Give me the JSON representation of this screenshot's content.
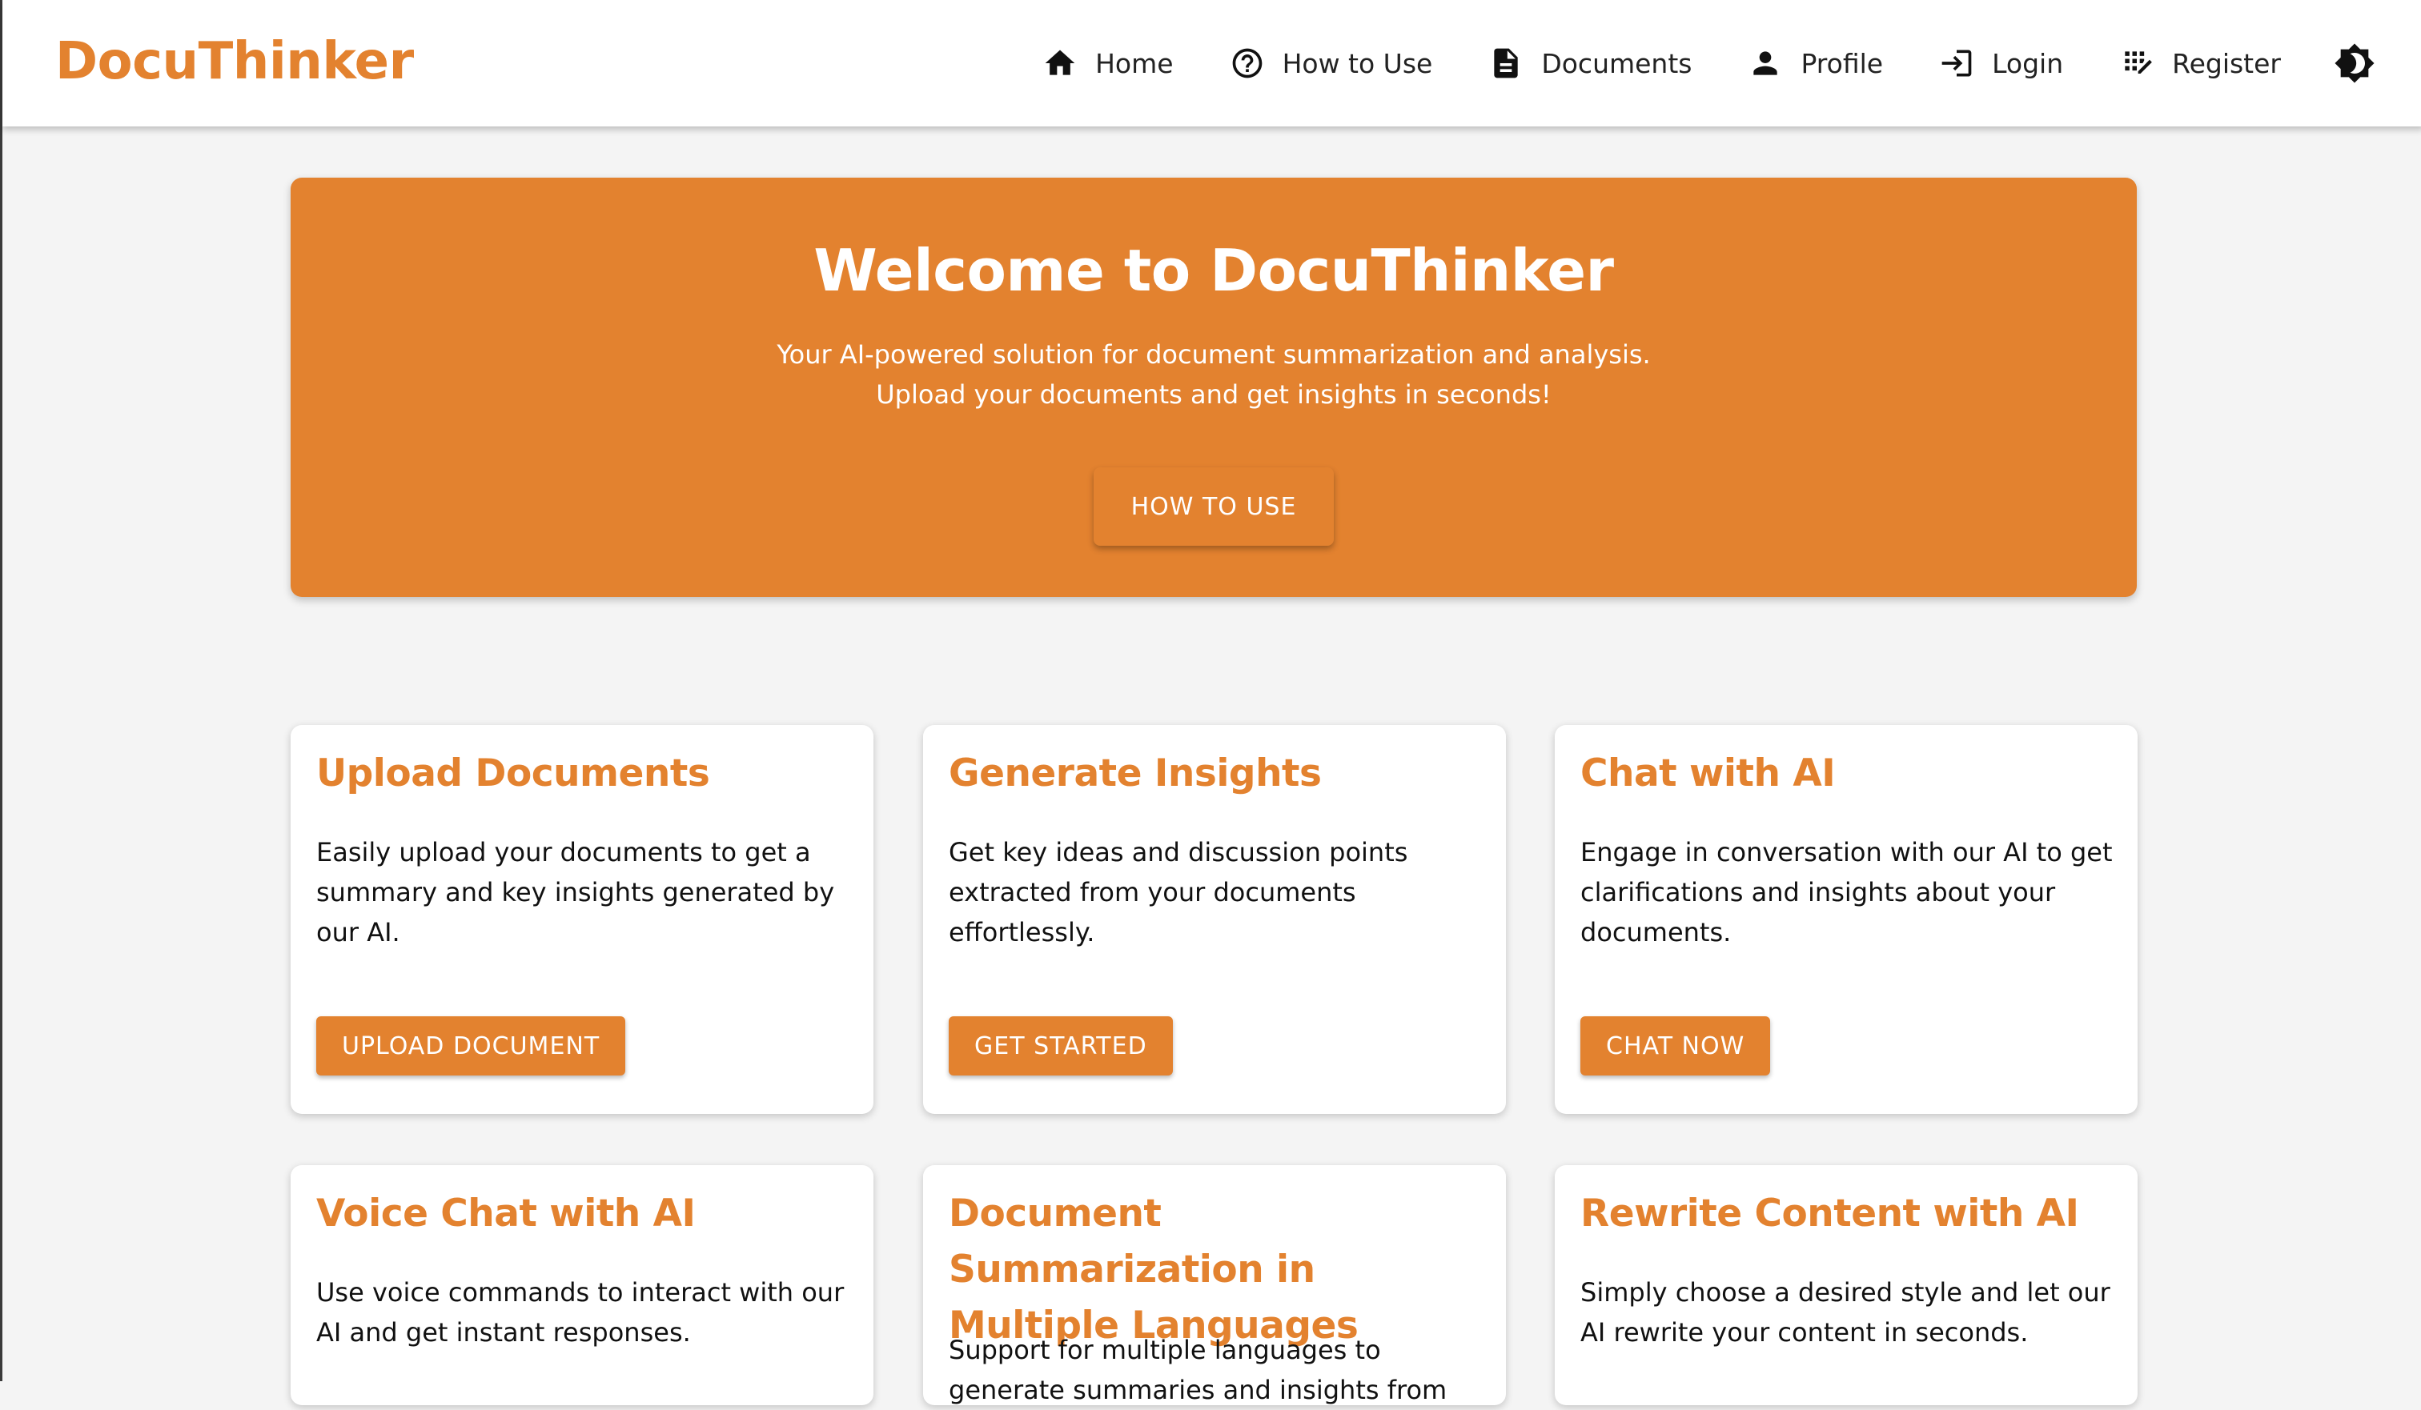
{
  "navbar": {
    "brand": "DocuThinker",
    "items": [
      {
        "label": "Home",
        "icon": "home-icon"
      },
      {
        "label": "How to Use",
        "icon": "help-circle-icon"
      },
      {
        "label": "Documents",
        "icon": "document-icon"
      },
      {
        "label": "Profile",
        "icon": "person-icon"
      },
      {
        "label": "Login",
        "icon": "login-icon"
      },
      {
        "label": "Register",
        "icon": "register-icon"
      }
    ],
    "theme_toggle_icon": "brightness-icon"
  },
  "hero": {
    "title": "Welcome to DocuThinker",
    "subtitle_line1": "Your AI-powered solution for document summarization and analysis.",
    "subtitle_line2": "Upload your documents and get insights in seconds!",
    "button_label": "HOW TO USE"
  },
  "features": [
    {
      "title": "Upload Documents",
      "text": "Easily upload your documents to get a summary and key insights generated by our AI.",
      "button": "UPLOAD DOCUMENT"
    },
    {
      "title": "Generate Insights",
      "text": "Get key ideas and discussion points extracted from your documents effortlessly.",
      "button": "GET STARTED"
    },
    {
      "title": "Chat with AI",
      "text": "Engage in conversation with our AI to get clarifications and insights about your documents.",
      "button": "CHAT NOW"
    },
    {
      "title": "Voice Chat with AI",
      "text": "Use voice commands to interact with our AI and get instant responses."
    },
    {
      "title": "Document Summarization in Multiple Languages",
      "text": "Support for multiple languages to generate summaries and insights from"
    },
    {
      "title": "Rewrite Content with AI",
      "text": "Simply choose a desired style and let our AI rewrite your content in seconds."
    }
  ],
  "colors": {
    "accent": "#e3822f",
    "background": "#f4f4f4",
    "card": "#ffffff"
  }
}
